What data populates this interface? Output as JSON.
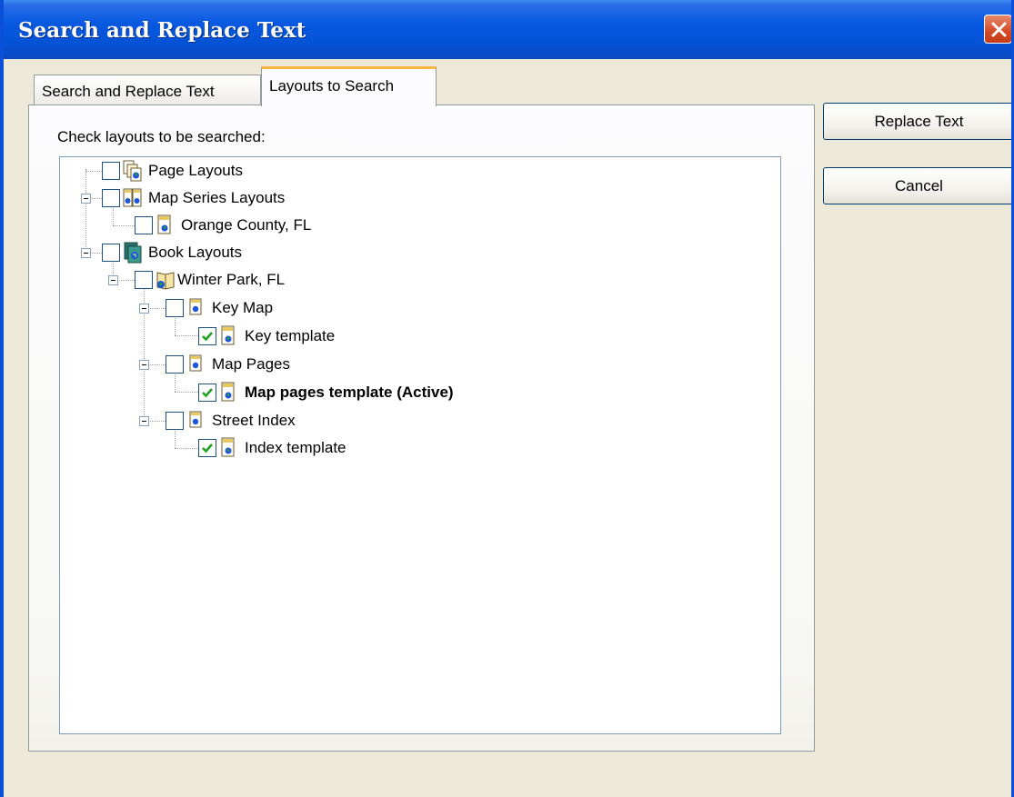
{
  "window": {
    "title": "Search and Replace Text"
  },
  "tabs": [
    {
      "label": "Search and Replace Text",
      "active": false
    },
    {
      "label": "Layouts to Search",
      "active": true
    }
  ],
  "panel": {
    "instruction": "Check layouts to be searched:"
  },
  "tree": [
    {
      "label": "Page Layouts",
      "checked": false,
      "icon": "page-layouts-icon"
    },
    {
      "label": "Map Series Layouts",
      "checked": false,
      "icon": "map-series-layouts-icon",
      "expanded": true
    },
    {
      "label": "Orange County, FL",
      "checked": false,
      "icon": "layout-document-icon"
    },
    {
      "label": "Book Layouts",
      "checked": false,
      "icon": "book-layouts-icon",
      "expanded": true
    },
    {
      "label": "Winter Park, FL",
      "checked": false,
      "icon": "book-icon",
      "expanded": true
    },
    {
      "label": "Key Map",
      "checked": false,
      "icon": "section-icon",
      "expanded": true
    },
    {
      "label": "Key template",
      "checked": true,
      "icon": "layout-document-icon"
    },
    {
      "label": "Map Pages",
      "checked": false,
      "icon": "section-icon",
      "expanded": true
    },
    {
      "label": "Map pages template (Active)",
      "checked": true,
      "icon": "layout-document-icon",
      "bold": true
    },
    {
      "label": "Street Index",
      "checked": false,
      "icon": "section-icon",
      "expanded": true
    },
    {
      "label": "Index template",
      "checked": true,
      "icon": "layout-document-icon"
    }
  ],
  "buttons": {
    "replace": "Replace Text",
    "cancel": "Cancel"
  },
  "colors": {
    "titlebar": "#0758e0",
    "checkmark": "#21a121",
    "tab_highlight": "#f8b53d",
    "close_button": "#d44a26"
  }
}
